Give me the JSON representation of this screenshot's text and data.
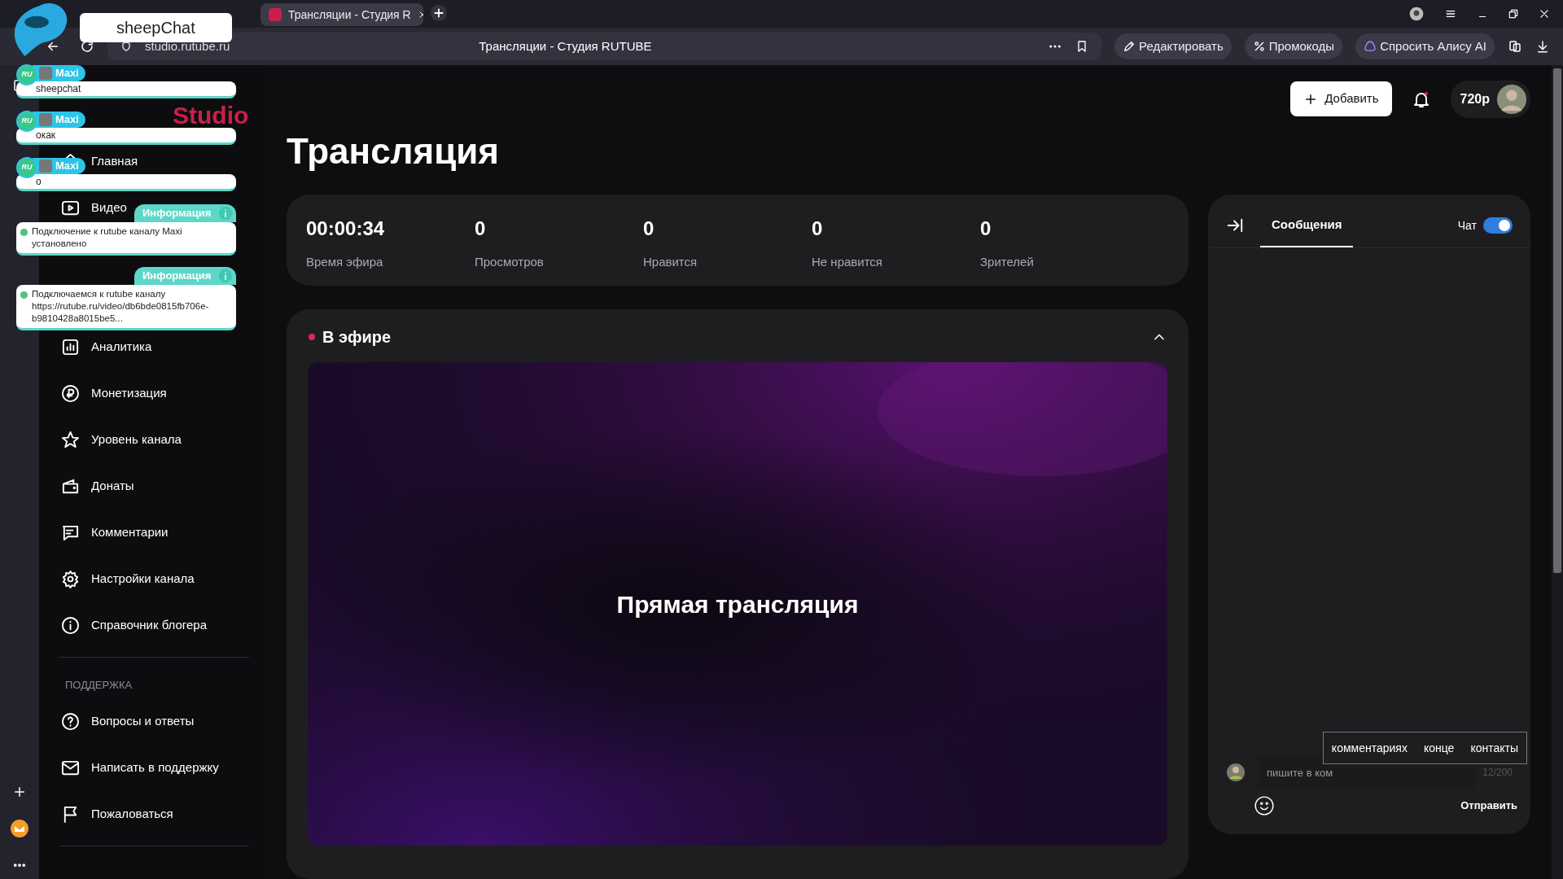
{
  "browser": {
    "tabs": [
      {
        "label": "Трансляции - Студия R",
        "selected": true
      }
    ],
    "address": "studio.rutube.ru",
    "page_title": "Трансляции - Студия RUTUBE",
    "toolbar_buttons": [
      {
        "label": "Редактировать"
      },
      {
        "label": "Промокоды"
      },
      {
        "label": "Спросить Алису AI"
      }
    ]
  },
  "header": {
    "logo_suffix": "Studio",
    "add_button": "Добавить",
    "quality": "720p"
  },
  "sidebar": {
    "nav_top": [
      {
        "label": "Главная"
      },
      {
        "label": "Видео"
      }
    ],
    "nav_main": [
      {
        "label": "Аналитика"
      },
      {
        "label": "Монетизация"
      },
      {
        "label": "Уровень канала"
      },
      {
        "label": "Донаты"
      },
      {
        "label": "Комментарии"
      },
      {
        "label": "Настройки канала"
      },
      {
        "label": "Справочник блогера"
      }
    ],
    "support_heading": "ПОДДЕРЖКА",
    "support": [
      {
        "label": "Вопросы и ответы"
      },
      {
        "label": "Написать в поддержку"
      },
      {
        "label": "Пожаловаться"
      }
    ]
  },
  "page_title": "Трансляция",
  "stats": [
    {
      "value": "00:00:34",
      "label": "Время эфира"
    },
    {
      "value": "0",
      "label": "Просмотров"
    },
    {
      "value": "0",
      "label": "Нравится"
    },
    {
      "value": "0",
      "label": "Не нравится"
    },
    {
      "value": "0",
      "label": "Зрителей"
    }
  ],
  "live": {
    "title": "В эфире",
    "player_text": "Прямая трансляция"
  },
  "chat": {
    "tabs": [
      {
        "label": "Сообщения",
        "selected": true
      }
    ],
    "toggle": {
      "label": "Чат",
      "on": true
    },
    "input": {
      "value": "пишите в ком"
    },
    "counter": "12/200",
    "suggestions": [
      "комментариях",
      "конце",
      "контакты"
    ],
    "send": "Отправить"
  },
  "overlay": {
    "app_name": "sheepChat",
    "messages": [
      {
        "kind": "user",
        "author": "Maxi",
        "badge": "RU",
        "text": "sheepchat"
      },
      {
        "kind": "user",
        "author": "Maxi",
        "badge": "RU",
        "text": "окак"
      },
      {
        "kind": "user",
        "author": "Maxi",
        "badge": "RU",
        "text": "о"
      },
      {
        "kind": "info",
        "title": "Информация",
        "text": "Подключение к rutube каналу Maxi установлено"
      },
      {
        "kind": "info",
        "title": "Информация",
        "text": "Подключаемся к rutube каналу https://rutube.ru/video/db6bde0815fb706e-b9810428a8015be5..."
      }
    ]
  }
}
